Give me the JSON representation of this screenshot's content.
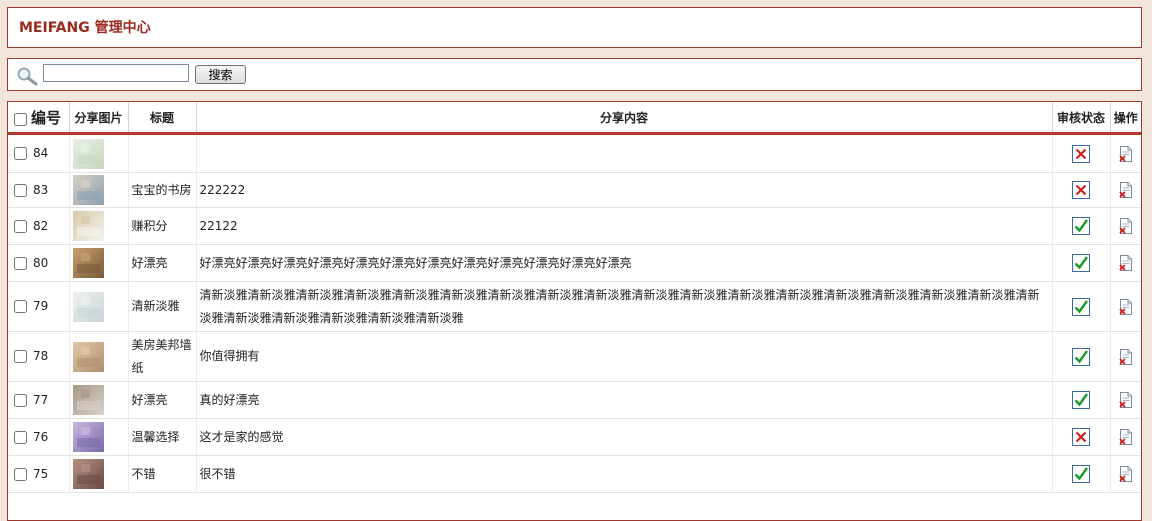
{
  "header": {
    "title": "MEIFANG 管理中心"
  },
  "search": {
    "value": "",
    "button_label": "搜索"
  },
  "table": {
    "columns": {
      "id": "编号",
      "image": "分享图片",
      "title": "标题",
      "content": "分享内容",
      "status": "审核状态",
      "action": "操作"
    },
    "rows": [
      {
        "id": "84",
        "title": "",
        "content": "",
        "approved": false,
        "thumb_colors": [
          "#c8d8c0",
          "#e8efe4"
        ]
      },
      {
        "id": "83",
        "title": "宝宝的书房",
        "content": "222222",
        "approved": false,
        "thumb_colors": [
          "#8aa0b0",
          "#d8d0c4"
        ]
      },
      {
        "id": "82",
        "title": "赚积分",
        "content": "22122",
        "approved": true,
        "thumb_colors": [
          "#f4f4f0",
          "#d8c8a8"
        ]
      },
      {
        "id": "80",
        "title": "好漂亮",
        "content": "好漂亮好漂亮好漂亮好漂亮好漂亮好漂亮好漂亮好漂亮好漂亮好漂亮好漂亮好漂亮",
        "approved": true,
        "thumb_colors": [
          "#7a5a3a",
          "#c8a070"
        ]
      },
      {
        "id": "79",
        "title": "清新淡雅",
        "content": "清新淡雅清新淡雅清新淡雅清新淡雅清新淡雅清新淡雅清新淡雅清新淡雅清新淡雅清新淡雅清新淡雅清新淡雅清新淡雅清新淡雅清新淡雅清新淡雅清新淡雅清新淡雅清新淡雅清新淡雅清新淡雅清新淡雅清新淡雅",
        "approved": true,
        "thumb_colors": [
          "#c8d4d8",
          "#eef0ee"
        ]
      },
      {
        "id": "78",
        "title": "美房美邦墙纸",
        "content": "你值得拥有",
        "approved": true,
        "thumb_colors": [
          "#b09070",
          "#e0c8a8"
        ]
      },
      {
        "id": "77",
        "title": "好漂亮",
        "content": "真的好漂亮",
        "approved": true,
        "thumb_colors": [
          "#d8d0c8",
          "#a89888"
        ]
      },
      {
        "id": "76",
        "title": "温馨选择",
        "content": "这才是家的感觉",
        "approved": false,
        "thumb_colors": [
          "#7a6aa8",
          "#c8b8e0"
        ]
      },
      {
        "id": "75",
        "title": "不错",
        "content": "很不错",
        "approved": true,
        "thumb_colors": [
          "#6a4a48",
          "#b89080"
        ]
      }
    ]
  },
  "icons": {
    "search": "magnifier-icon",
    "approved": "check-icon",
    "rejected": "cross-icon",
    "delete": "delete-document-icon"
  },
  "colors": {
    "brand": "#9b2a1e",
    "page_bg": "#f2e6dc",
    "approved": "#1a9a2a",
    "rejected": "#d02020"
  }
}
